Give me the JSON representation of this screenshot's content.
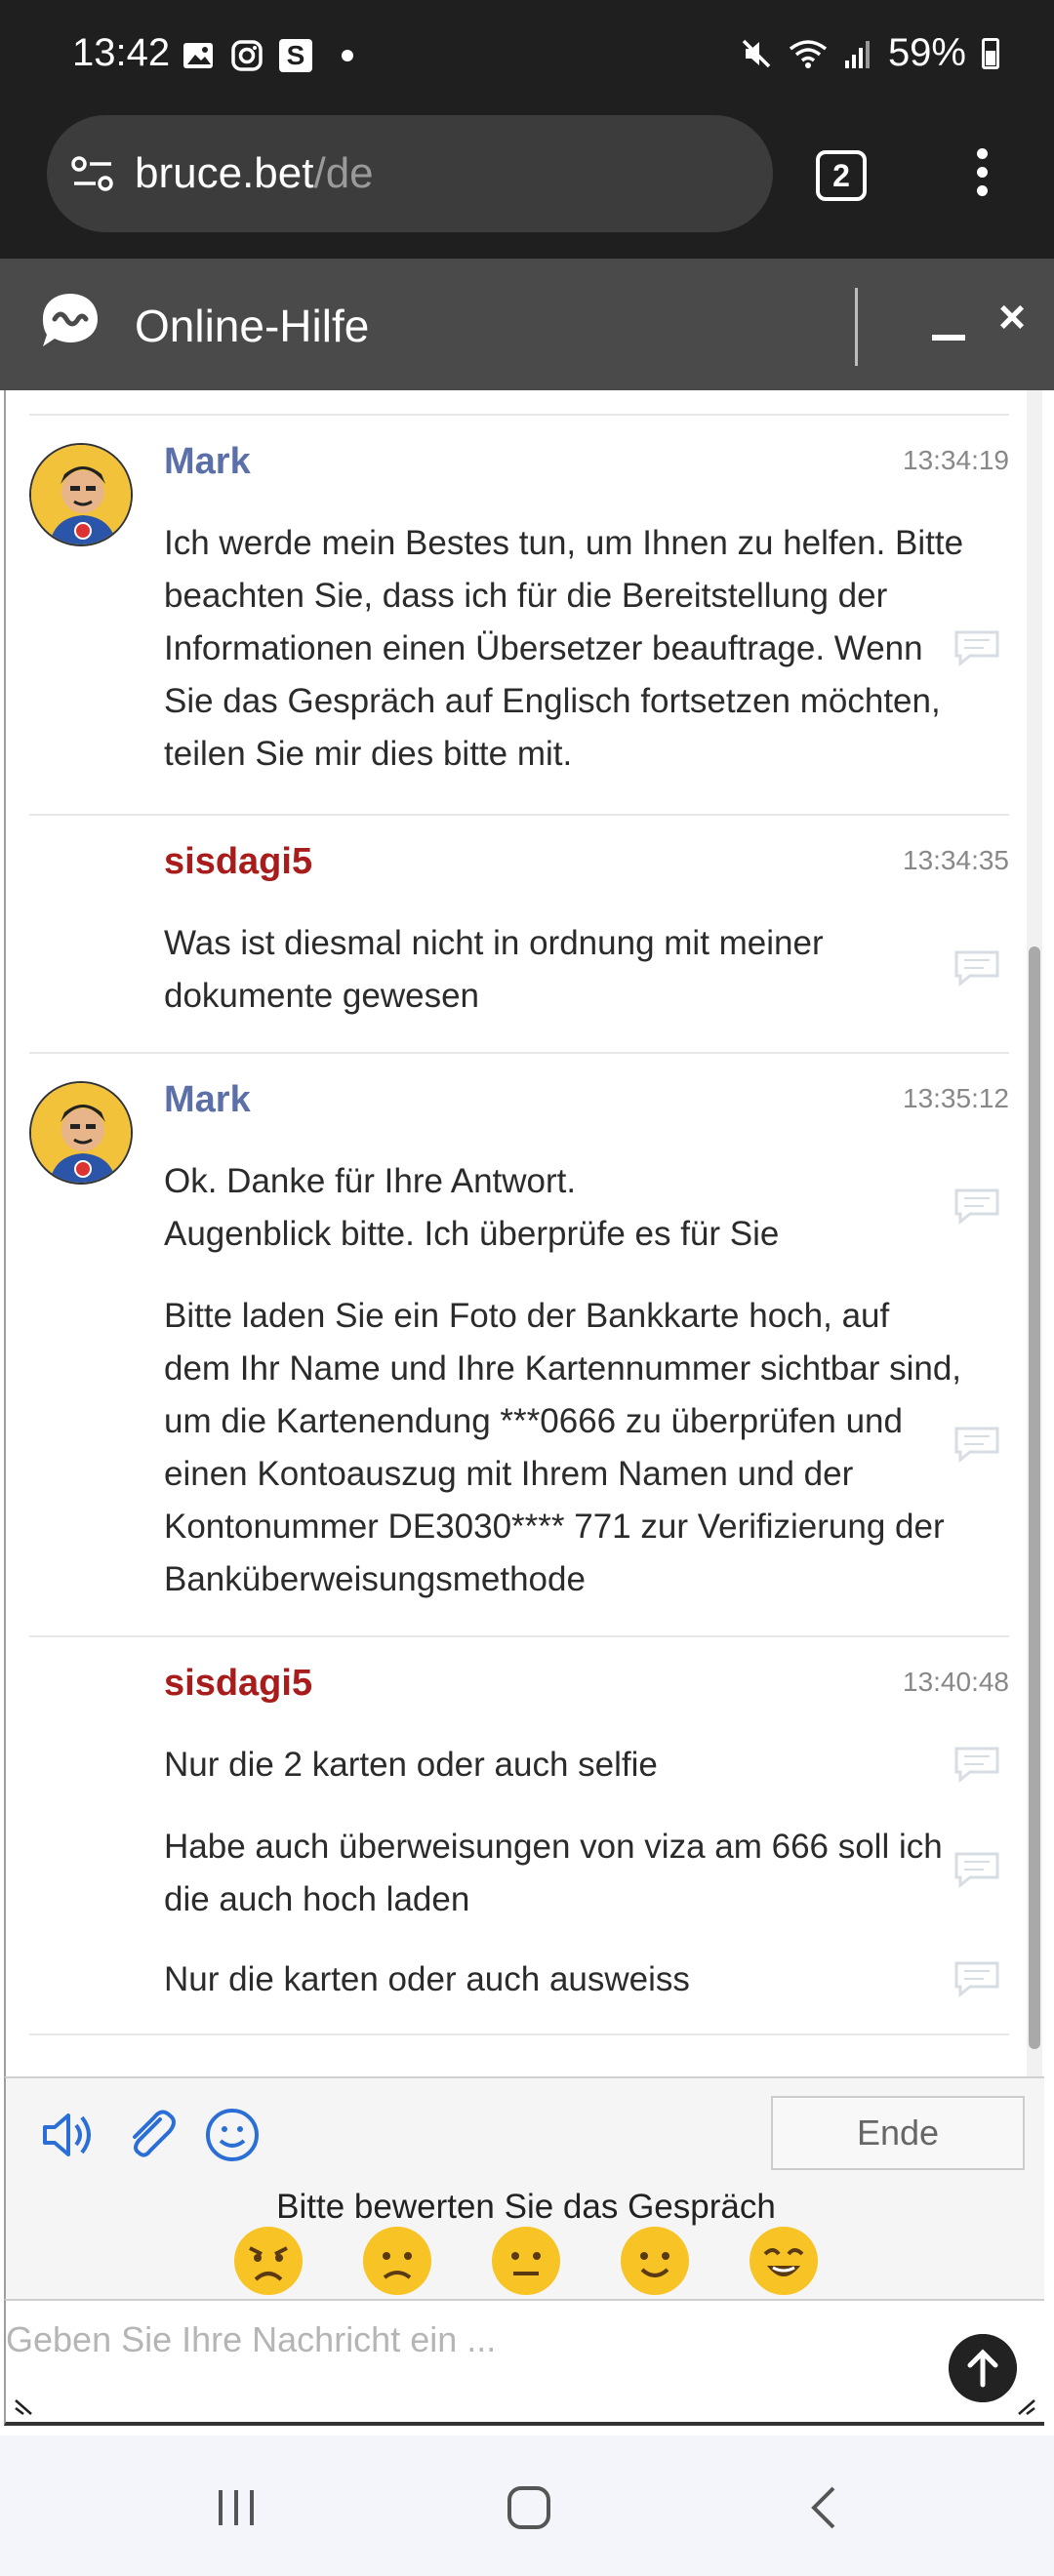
{
  "status_bar": {
    "time": "13:42",
    "left_icons": [
      "image-icon",
      "instagram-icon",
      "s-app-icon",
      "dot-icon"
    ],
    "s_icon_label": "S",
    "right_icons": [
      "mute-icon",
      "wifi-icon",
      "signal-icon"
    ],
    "battery": "59%"
  },
  "browser": {
    "url_domain": "bruce.bet",
    "url_path": "/de",
    "tab_count": "2"
  },
  "chat_header": {
    "title": "Online-Hilfe"
  },
  "messages": [
    {
      "author": "Mark",
      "role": "agent",
      "time": "13:34:19",
      "parts": [
        "Ich werde mein Bestes tun, um Ihnen zu helfen. Bitte beachten Sie, dass ich für die Bereitstellung der Informationen einen Übersetzer beauftrage. Wenn Sie das Gespräch auf Englisch fortsetzen möchten, teilen Sie mir dies bitte mit."
      ]
    },
    {
      "author": "sisdagi5",
      "role": "user",
      "time": "13:34:35",
      "parts": [
        "Was ist diesmal nicht in ordnung mit meiner dokumente gewesen"
      ]
    },
    {
      "author": "Mark",
      "role": "agent",
      "time": "13:35:12",
      "parts": [
        "Ok. Danke für Ihre Antwort.\nAugenblick bitte. Ich überprüfe es für Sie",
        "Bitte laden Sie ein Foto der Bankkarte hoch, auf dem Ihr Name und Ihre Kartennummer sichtbar sind, um die Kartenendung ***0666 zu überprüfen und einen Kontoauszug mit Ihrem Namen und der Kontonummer DE3030**** 771 zur Verifizierung der Banküberweisungsmethode"
      ]
    },
    {
      "author": "sisdagi5",
      "role": "user",
      "time": "13:40:48",
      "parts": [
        "Nur die 2 karten oder auch selfie",
        "Habe auch überweisungen von viza am 666 soll ich die auch hoch laden",
        "Nur die karten oder auch ausweiss"
      ]
    }
  ],
  "toolbar": {
    "end_label": "Ende",
    "rate_prompt": "Bitte bewerten Sie das Gespräch",
    "emojis": [
      "angry-face-icon",
      "sad-face-icon",
      "neutral-face-icon",
      "smile-face-icon",
      "heart-eyes-face-icon"
    ]
  },
  "input": {
    "placeholder": "Geben Sie Ihre Nachricht ein ..."
  },
  "colors": {
    "agent_name": "#5b6fa8",
    "user_name": "#a81c1c",
    "header_bg": "#4a4a4a",
    "toolbar_icon": "#2b6fd6",
    "emoji_yellow": "#f7c325"
  }
}
